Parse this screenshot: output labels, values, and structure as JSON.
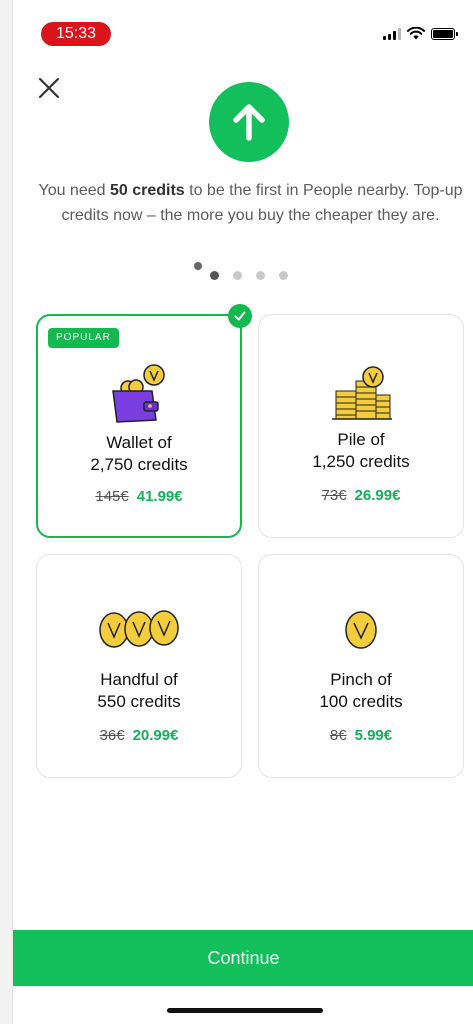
{
  "status_bar": {
    "time": "15:33"
  },
  "header": {
    "close_icon": "close-icon",
    "badge_icon": "arrow-up-icon"
  },
  "message": {
    "part1": "You need ",
    "bold": "50 credits",
    "part2": " to be the first in People nearby. Top-up credits now – the more you buy the cheaper they are."
  },
  "pager": {
    "total": 5,
    "active": 1
  },
  "packages": [
    {
      "badge": "POPULAR",
      "line1": "Wallet of",
      "line2": "2,750 credits",
      "old_price": "145€",
      "new_price": "41.99€",
      "selected": true,
      "icon": "wallet-icon"
    },
    {
      "line1": "Pile of",
      "line2": "1,250 credits",
      "old_price": "73€",
      "new_price": "26.99€",
      "selected": false,
      "icon": "coin-pile-icon"
    },
    {
      "line1": "Handful of",
      "line2": "550 credits",
      "old_price": "36€",
      "new_price": "20.99€",
      "selected": false,
      "icon": "coin-handful-icon"
    },
    {
      "line1": "Pinch of",
      "line2": "100 credits",
      "old_price": "8€",
      "new_price": "5.99€",
      "selected": false,
      "icon": "coin-icon"
    }
  ],
  "cta": {
    "label": "Continue"
  },
  "colors": {
    "accent": "#13b84e",
    "price": "#13b05a",
    "coin": "#f4cd3c",
    "wallet": "#7a3de0"
  }
}
